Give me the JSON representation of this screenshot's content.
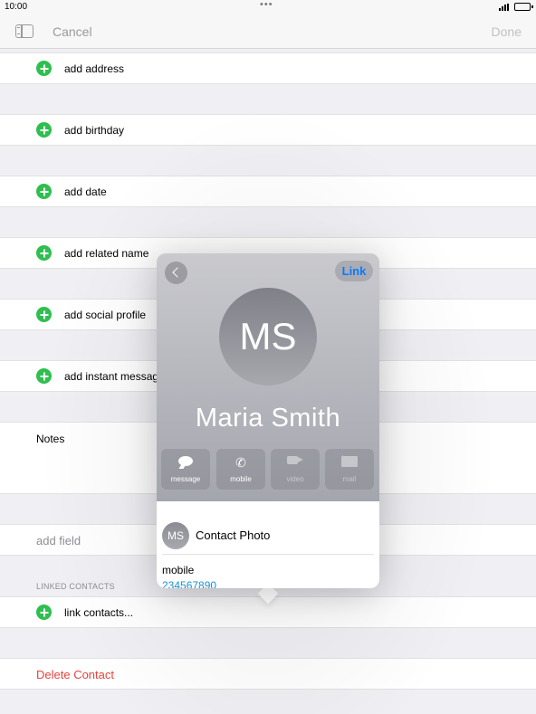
{
  "status_bar": {
    "time": "10:00",
    "dots": "•••"
  },
  "nav": {
    "cancel_label": "Cancel",
    "done_label": "Done"
  },
  "rows": {
    "add_address": "add address",
    "add_birthday": "add birthday",
    "add_date": "add date",
    "add_related_name": "add related name",
    "add_social_profile": "add social profile",
    "add_instant_message": "add instant messag",
    "notes": "Notes",
    "add_field": "add field",
    "linked_contacts_header": "LINKED CONTACTS",
    "link_contacts": "link contacts...",
    "delete_contact": "Delete Contact"
  },
  "popover": {
    "link_label": "Link",
    "initials": "MS",
    "name": "Maria  Smith",
    "actions": [
      {
        "label": "message",
        "icon": "message-bubble-icon",
        "enabled": true
      },
      {
        "label": "mobile",
        "icon": "phone-icon",
        "enabled": true
      },
      {
        "label": "video",
        "icon": "video-camera-icon",
        "enabled": false
      },
      {
        "label": "mail",
        "icon": "envelope-icon",
        "enabled": false
      }
    ],
    "photo_row_initials": "MS",
    "photo_row_label": "Contact Photo",
    "mobile_label": "mobile",
    "mobile_number": "234567890"
  },
  "colors": {
    "accent_green": "#2fbf4f",
    "link_blue": "#0a7aff",
    "delete_red": "#e8423b",
    "number_blue": "#1a8fd6"
  }
}
